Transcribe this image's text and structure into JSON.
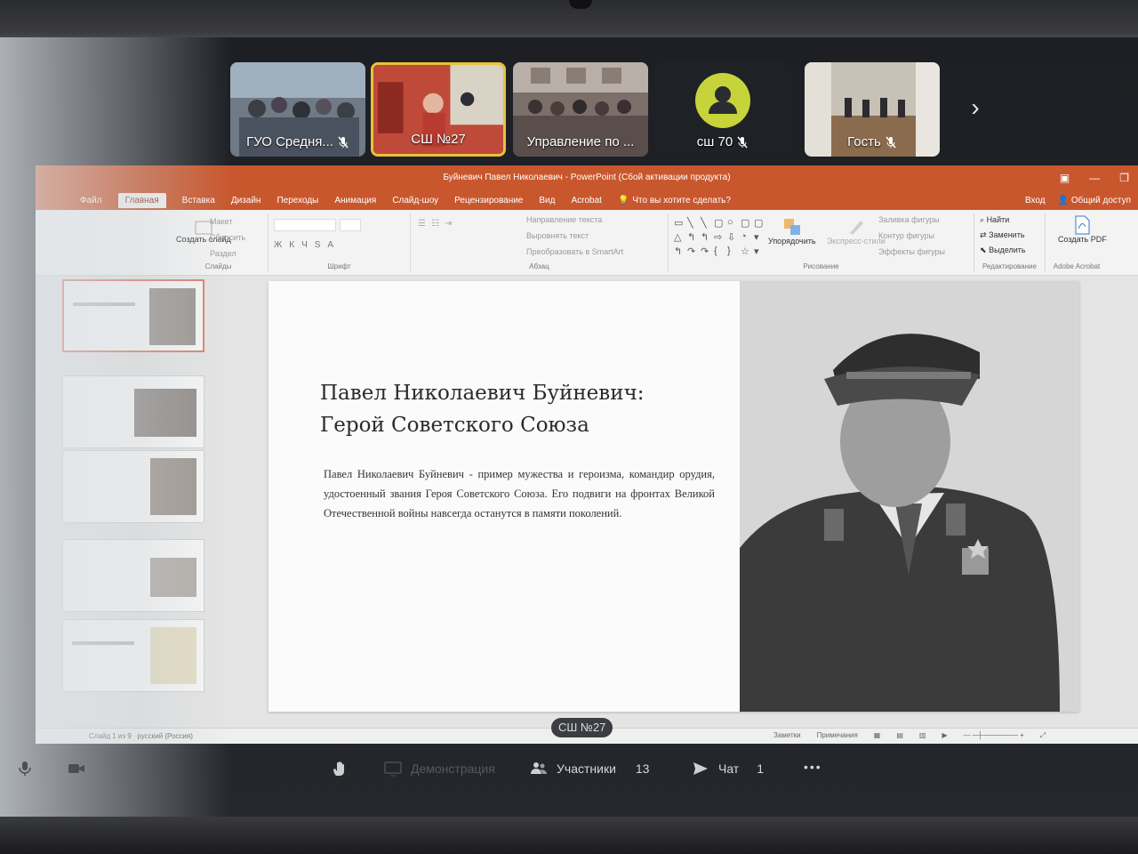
{
  "participants": [
    {
      "name": "ГУО Средня...",
      "muted": true,
      "active": false
    },
    {
      "name": "СШ №27",
      "muted": false,
      "active": true
    },
    {
      "name": "Управление по ...",
      "muted": false,
      "active": false
    },
    {
      "name": "сш 70",
      "muted": true,
      "active": false,
      "avatar": "person-icon"
    },
    {
      "name": "Гость",
      "muted": true,
      "active": false
    }
  ],
  "powerpoint": {
    "window_title": "Буйневич Павел Николаевич - PowerPoint (Сбой активации продукта)",
    "tabs": [
      "Файл",
      "Главная",
      "Вставка",
      "Дизайн",
      "Переходы",
      "Анимация",
      "Слайд-шоу",
      "Рецензирование",
      "Вид",
      "Acrobat"
    ],
    "tell_me": "Что вы хотите сделать?",
    "sign_in": "Вход",
    "share": "Общий доступ",
    "ribbon": {
      "slides": {
        "layout": "Макет",
        "reset": "Сбросить",
        "section": "Раздел",
        "new_slide": "Создать слайд",
        "caption": "Слайды"
      },
      "font_caption": "Шрифт",
      "paragraph": {
        "text_direction": "Направление текста",
        "align_text": "Выровнять текст",
        "smartart": "Преобразовать в SmartArt",
        "caption": "Абзац"
      },
      "drawing": {
        "arrange": "Упорядочить",
        "quick_styles": "Экспресс-стили",
        "fill": "Заливка фигуры",
        "outline": "Контур фигуры",
        "effects": "Эффекты фигуры",
        "caption": "Рисование"
      },
      "editing": {
        "find": "Найти",
        "replace": "Заменить",
        "select": "Выделить",
        "caption": "Редактирование"
      },
      "acrobat": {
        "create_pdf": "Создать PDF",
        "caption": "Adobe Acrobat"
      }
    },
    "slide": {
      "title_line1": "Павел Николаевич Буйневич:",
      "title_line2": "Герой Советского Союза",
      "body": "Павел Николаевич Буйневич - пример мужества и героизма, командир орудия, удостоенный звания Героя Советского Союза. Его подвиги на фронтах Великой Отечественной войны навсегда останутся в памяти поколений."
    },
    "status": {
      "slide_counter": "Слайд 1 из 9",
      "language": "русский (Россия)",
      "notes": "Заметки",
      "comments": "Примечания"
    }
  },
  "presenter_label": "СШ №27",
  "toolbar": {
    "demo": "Демонстрация",
    "participants_label": "Участники",
    "participants_count": "13",
    "chat_label": "Чат",
    "chat_count": "1",
    "more": "•••"
  },
  "colors": {
    "ppt_orange": "#c8572e",
    "active_tile": "#e6c23b",
    "avatar": "#c7d33a"
  }
}
